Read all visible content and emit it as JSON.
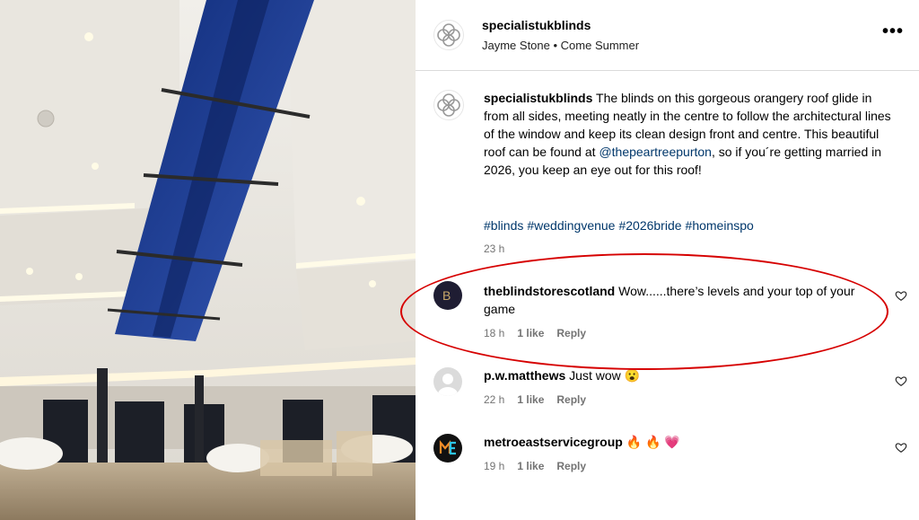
{
  "header": {
    "username": "specialistukblinds",
    "subtitle": "Jayme Stone • Come Summer",
    "more_label": "•••"
  },
  "caption": {
    "username": "specialistukblinds",
    "text_before": " The blinds on this gorgeous orangery roof glide in from all sides, meeting neatly in the centre to follow the architectural lines of the window and keep its clean design front and centre. This beautiful roof can be found at ",
    "mention": "@thepeartreepurton",
    "text_after": ", so if you´re getting married in 2026, you keep an eye out for this roof!",
    "hashtags": [
      "#blinds",
      "#weddingvenue",
      "#2026bride",
      "#homeinspo"
    ],
    "time": "23 h"
  },
  "comments": [
    {
      "username": "theblindstorescotland",
      "text": " Wow......there’s levels and your top of your game",
      "time": "18 h",
      "likes": "1 like",
      "reply": "Reply",
      "avatar_letter": "B"
    },
    {
      "username": "p.w.matthews",
      "text": " Just wow 😮",
      "time": "22 h",
      "likes": "1 like",
      "reply": "Reply"
    },
    {
      "username": "metroeastservicegroup",
      "text": " 🔥 🔥 💗",
      "time": "19 h",
      "likes": "1 like",
      "reply": "Reply"
    }
  ],
  "colors": {
    "link": "#00376b",
    "meta": "#737373",
    "highlight_circle": "#d60000"
  }
}
